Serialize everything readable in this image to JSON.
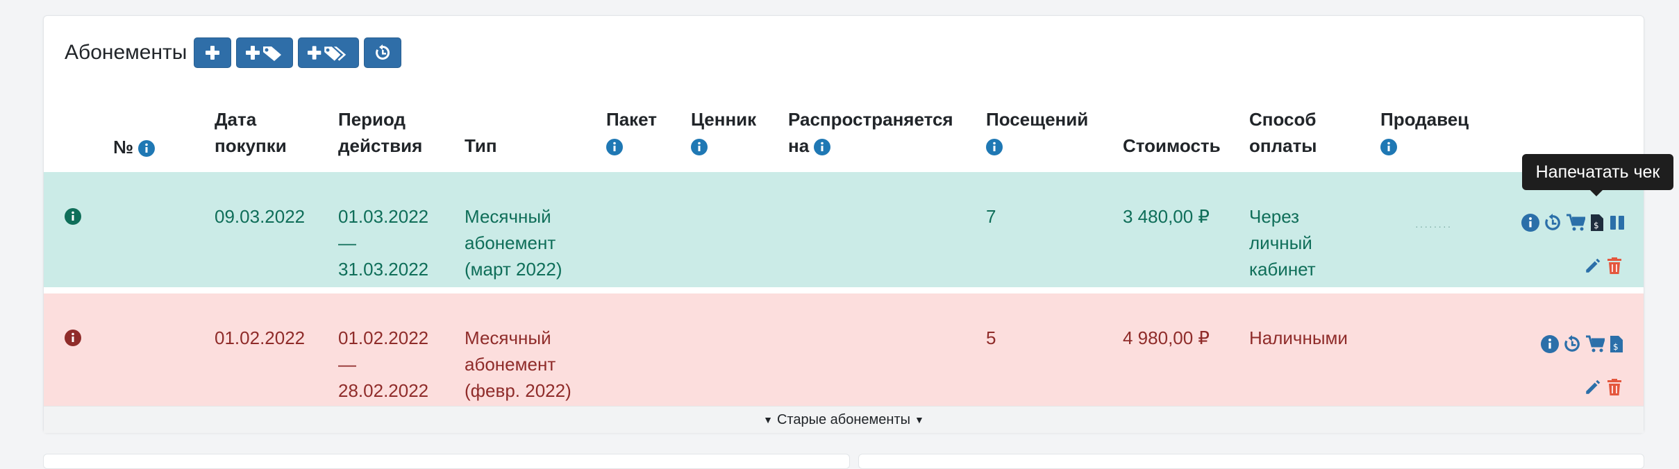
{
  "panel": {
    "title": "Абонементы",
    "toolbar": [
      {
        "icon": "plus-icon"
      },
      {
        "icon": "plus-tag-icon"
      },
      {
        "icon": "plus-tags-icon"
      },
      {
        "icon": "history-icon"
      }
    ]
  },
  "table": {
    "headers": {
      "num": "№",
      "purchase_date": [
        "Дата",
        "покупки"
      ],
      "period": [
        "Период",
        "действия"
      ],
      "type": "Тип",
      "package": "Пакет",
      "price_list": "Ценник",
      "applies_to": [
        "Распространяется",
        "на"
      ],
      "visits": "Посещений",
      "cost": "Стоимость",
      "payment": [
        "Способ",
        "оплаты"
      ],
      "seller": "Продавец"
    },
    "rows": [
      {
        "status": "active",
        "purchase_date": "09.03.2022",
        "period_start": "01.03.2022",
        "period_dash": "—",
        "period_end": "31.03.2022",
        "type_lines": [
          "Месячный",
          "абонемент",
          "(март 2022)"
        ],
        "visits": "7",
        "cost": "3 480,00 ₽",
        "payment_lines": [
          "Через",
          "личный",
          "кабинет"
        ]
      },
      {
        "status": "expired",
        "purchase_date": "01.02.2022",
        "period_start": "01.02.2022",
        "period_dash": "—",
        "period_end": "28.02.2022",
        "type_lines": [
          "Месячный",
          "абонемент",
          "(февр. 2022)"
        ],
        "visits": "5",
        "cost": "4 980,00 ₽",
        "payment_lines": [
          "Наличными"
        ]
      }
    ],
    "footer_toggle": "Старые абонементы"
  },
  "tooltip": "Напечатать чек",
  "colors": {
    "primary_button": "#2f6ea8",
    "active_row": "#cbebe7",
    "expired_row": "#fcdedd",
    "delete_icon": "#e4573d",
    "action_icon": "#2b6fa9"
  }
}
